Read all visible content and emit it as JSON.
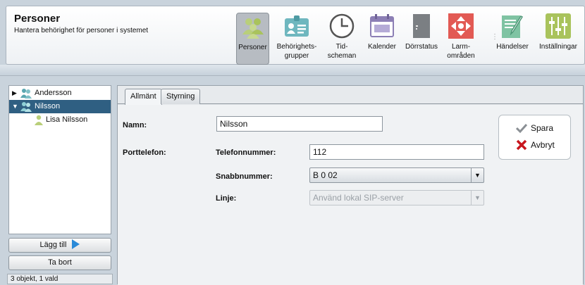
{
  "header": {
    "title": "Personer",
    "subtitle": "Hantera behörighet för personer i systemet"
  },
  "toolbar": {
    "items": [
      {
        "label_line1": "Personer",
        "label_line2": "",
        "icon": "people-icon",
        "active": true
      },
      {
        "label_line1": "Behörighets-",
        "label_line2": "grupper",
        "icon": "id-card-icon",
        "active": false
      },
      {
        "label_line1": "Tid-",
        "label_line2": "scheman",
        "icon": "clock-icon",
        "active": false
      },
      {
        "label_line1": "Kalender",
        "label_line2": "",
        "icon": "calendar-icon",
        "active": false
      },
      {
        "label_line1": "Dörrstatus",
        "label_line2": "",
        "icon": "door-icon",
        "active": false
      },
      {
        "label_line1": "Larm-",
        "label_line2": "områden",
        "icon": "alarm-areas-icon",
        "active": false
      },
      {
        "label_line1": "Händelser",
        "label_line2": "",
        "icon": "notepad-icon",
        "active": false
      },
      {
        "label_line1": "Inställningar",
        "label_line2": "",
        "icon": "sliders-icon",
        "active": false
      }
    ],
    "overflow_glyph": "⋮"
  },
  "tree": {
    "items": [
      {
        "label": "Andersson",
        "arrow": "▶",
        "type": "group"
      },
      {
        "label": "Nilsson",
        "arrow": "▼",
        "type": "group",
        "selected": true
      },
      {
        "label": "Lisa Nilsson",
        "arrow": "",
        "type": "person"
      }
    ]
  },
  "buttons": {
    "add": "Lägg till",
    "remove": "Ta bort"
  },
  "status": "3 objekt, 1 vald",
  "tabs": [
    "Allmänt",
    "Styrning"
  ],
  "form": {
    "name_label": "Namn:",
    "name_value": "Nilsson",
    "doorphone_label": "Porttelefon:",
    "phone_label": "Telefonnummer:",
    "phone_value": "112",
    "speed_label": "Snabbnummer:",
    "speed_value": "B 0 02",
    "line_label": "Linje:",
    "line_value": "Använd lokal SIP-server"
  },
  "actions": {
    "save": "Spara",
    "cancel": "Avbryt"
  },
  "colors": {
    "selected_row": "#2f5f82",
    "icon_green": "#9bc53d",
    "icon_teal": "#5aa7b0",
    "save_check": "#8a8f94",
    "cancel_x": "#c8161d",
    "play_arrow": "#2a8ad8"
  }
}
